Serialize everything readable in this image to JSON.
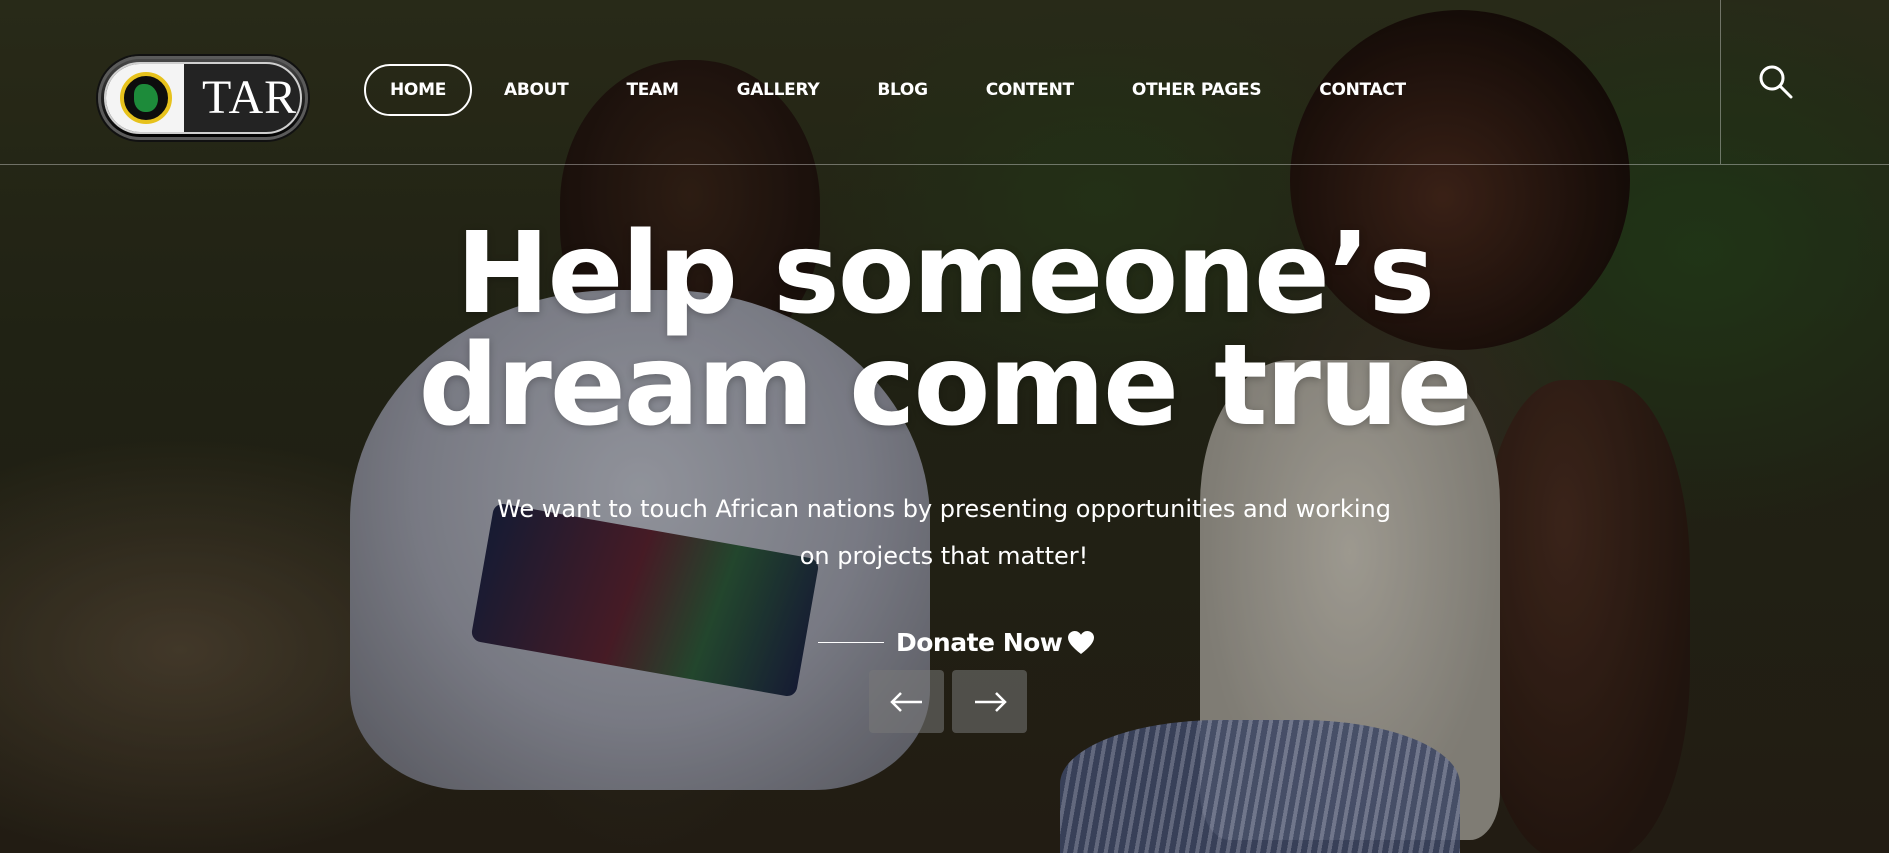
{
  "brand": {
    "logo_text": "TAR"
  },
  "nav": {
    "items": [
      {
        "label": "HOME",
        "active": true
      },
      {
        "label": "ABOUT",
        "active": false
      },
      {
        "label": "TEAM",
        "active": false
      },
      {
        "label": "GALLERY",
        "active": false
      },
      {
        "label": "BLOG",
        "active": false
      },
      {
        "label": "CONTENT",
        "active": false
      },
      {
        "label": "OTHER PAGES",
        "active": false
      },
      {
        "label": "CONTACT",
        "active": false
      }
    ],
    "search_icon": "search-icon"
  },
  "hero": {
    "headline_line1": "Help someone’s",
    "headline_line2": "dream come true",
    "subtext": "We want to touch African nations by presenting opportunities and working on projects that matter!",
    "donate_label": "Donate Now",
    "donate_icon": "heart-icon",
    "prev_icon": "arrow-left-icon",
    "next_icon": "arrow-right-icon"
  },
  "colors": {
    "text": "#ffffff",
    "logo_seal_ring": "#e7c21c",
    "logo_seal_map": "#1d8b3a",
    "arrow_button_bg": "#787878"
  }
}
